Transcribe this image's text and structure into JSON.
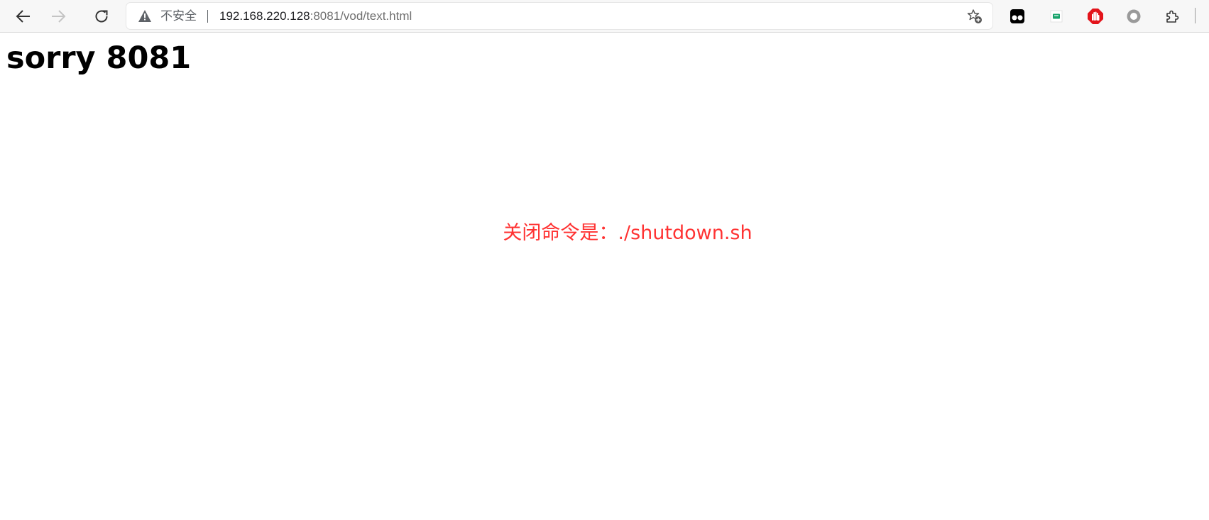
{
  "browser": {
    "toolbar": {
      "back_icon": "arrow-left-icon",
      "forward_icon": "arrow-right-icon",
      "forward_enabled": false,
      "reload_icon": "reload-icon"
    },
    "address_bar": {
      "security_icon": "warning-triangle-icon",
      "security_label": "不安全",
      "url_host": "192.168.220.128",
      "url_rest": ":8081/vod/text.html",
      "favorite_icon": "star-plus-icon"
    },
    "extensions": [
      {
        "name": "tampermonkey-extension-icon",
        "color": "#000000"
      },
      {
        "name": "green-flag-extension-icon",
        "color": "#18a36b"
      },
      {
        "name": "adblock-extension-icon",
        "color": "#e3141b"
      },
      {
        "name": "gray-circle-extension-icon",
        "color": "#9a9a9a"
      },
      {
        "name": "extensions-puzzle-icon",
        "color": "#3c3c3c"
      }
    ]
  },
  "page": {
    "heading": "sorry 8081",
    "notice": "关闭命令是：./shutdown.sh",
    "notice_color": "#ff3333"
  }
}
